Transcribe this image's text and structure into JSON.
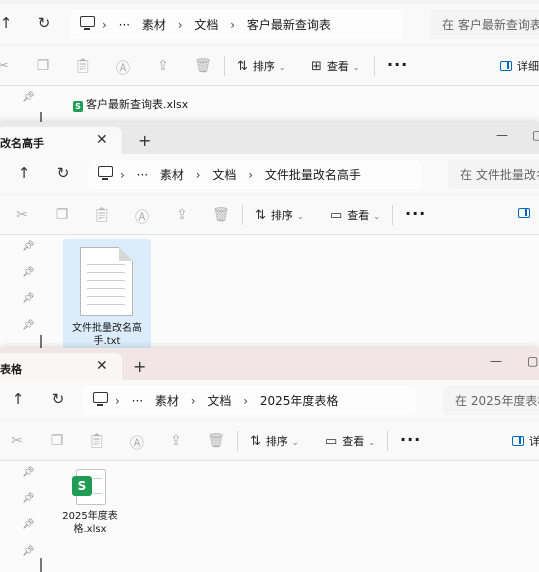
{
  "window1": {
    "breadcrumb": [
      "素材",
      "文档",
      "客户最新查询表"
    ],
    "search_placeholder": "在 客户最新查询表",
    "toolbar": {
      "sort": "排序",
      "view": "查看",
      "details": "详细"
    },
    "file": {
      "name": "客户最新查询表.xlsx",
      "icon": "excel-icon"
    }
  },
  "window2": {
    "tab_title": "改名高手",
    "breadcrumb": [
      "素材",
      "文档",
      "文件批量改名高手"
    ],
    "search_placeholder": "在 文件批量改名",
    "toolbar": {
      "sort": "排序",
      "view": "查看"
    },
    "file": {
      "name": "文件批量改名高手.txt",
      "icon": "text-file-icon",
      "selected": true
    }
  },
  "window3": {
    "tab_title": "表格",
    "breadcrumb": [
      "素材",
      "文档",
      "2025年度表格"
    ],
    "search_placeholder": "在 2025年度表格",
    "toolbar": {
      "sort": "排序",
      "view": "查看",
      "details": "详"
    },
    "file": {
      "name": "2025年度表格.xlsx",
      "icon": "excel-icon"
    }
  },
  "colors": {
    "selection": "#dcecfa",
    "accent": "#0067c0",
    "excel": "#1f9d55",
    "tab_tint": "#f2e5e6"
  }
}
